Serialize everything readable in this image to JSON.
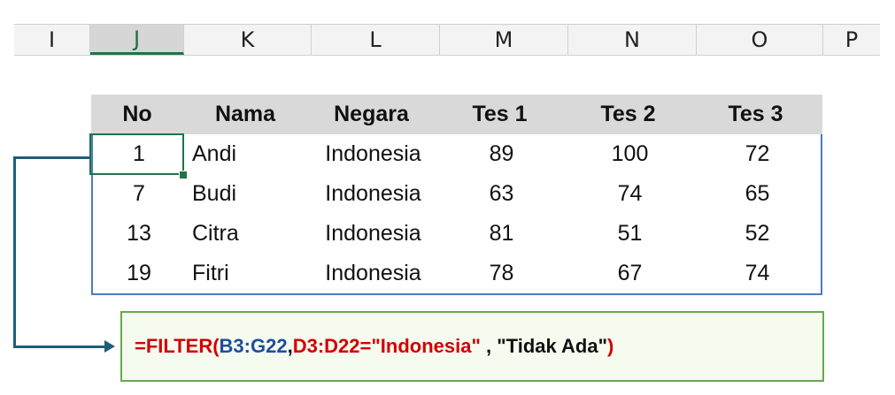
{
  "column_headers": [
    {
      "label": "I",
      "selected": false
    },
    {
      "label": "J",
      "selected": true
    },
    {
      "label": "K",
      "selected": false
    },
    {
      "label": "L",
      "selected": false
    },
    {
      "label": "M",
      "selected": false
    },
    {
      "label": "N",
      "selected": false
    },
    {
      "label": "O",
      "selected": false
    },
    {
      "label": "P",
      "selected": false
    }
  ],
  "table": {
    "headers": [
      "No",
      "Nama",
      "Negara",
      "Tes 1",
      "Tes 2",
      "Tes 3"
    ],
    "rows": [
      [
        "1",
        "Andi",
        "Indonesia",
        "89",
        "100",
        "72"
      ],
      [
        "7",
        "Budi",
        "Indonesia",
        "63",
        "74",
        "65"
      ],
      [
        "13",
        "Citra",
        "Indonesia",
        "81",
        "51",
        "52"
      ],
      [
        "19",
        "Fitri",
        "Indonesia",
        "78",
        "67",
        "74"
      ]
    ]
  },
  "formula": {
    "parts": [
      {
        "text": "=FILTER(",
        "color": "red"
      },
      {
        "text": "B3:G22",
        "color": "blue"
      },
      {
        "text": ",",
        "color": "black"
      },
      {
        "text": "D3:D22=\"Indonesia\"",
        "color": "red"
      },
      {
        "text": " , ",
        "color": "black"
      },
      {
        "text": "\"Tidak Ada\"",
        "color": "black"
      },
      {
        "text": ")",
        "color": "red"
      }
    ]
  },
  "colors": {
    "selection": "#217346",
    "table_border": "#4a7cc1",
    "header_bg": "#d9d9d9",
    "arrow": "#1f5c7a",
    "formula_border": "#6aa84f"
  }
}
